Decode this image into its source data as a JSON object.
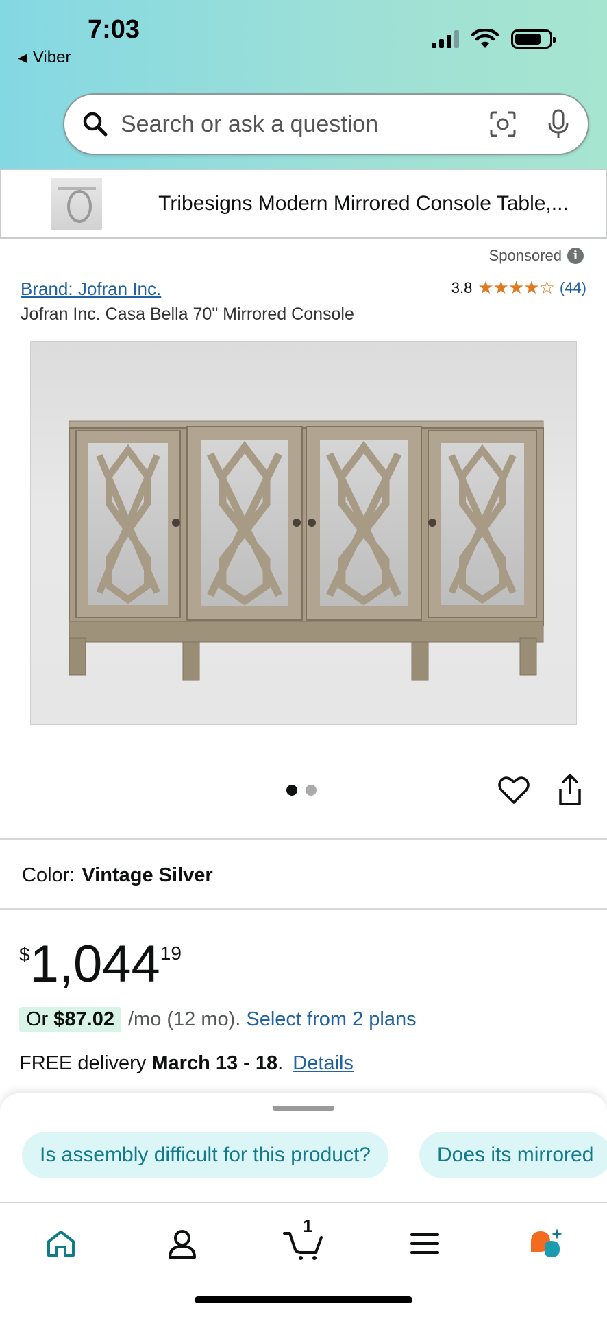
{
  "status_bar": {
    "time": "7:03",
    "back_app": "Viber"
  },
  "search": {
    "placeholder": "Search or ask a question",
    "left_icon": "search-icon",
    "camera_icon": "camera-scan-icon",
    "mic_icon": "microphone-icon"
  },
  "sponsored_product": {
    "title": "Tribesigns Modern Mirrored Console Table,..."
  },
  "ad": {
    "sponsored_label": "Sponsored",
    "info_icon": "i",
    "brand": "Brand: Jofran Inc.",
    "rating_value": "3.8",
    "rating_stars": "★★★★☆",
    "rating_count": "(44)",
    "title": "Jofran Inc. Casa Bella 70\" Mirrored Console"
  },
  "carousel": {
    "total": 2,
    "active_index": 0
  },
  "color": {
    "label": "Color:",
    "value": "Vintage Silver"
  },
  "price": {
    "currency": "$",
    "whole": "1,044",
    "fraction": "19"
  },
  "monthly": {
    "prefix": "Or ",
    "amount": "$87.02",
    "rest": "/mo (12 mo).",
    "plans_link": "Select from 2 plans"
  },
  "delivery": {
    "prefix": "FREE delivery ",
    "dates": "March 13 - 18",
    "suffix": ".",
    "details_link": "Details"
  },
  "rufus": {
    "chips": [
      "Is assembly difficult for this product?",
      "Does its mirrored"
    ]
  },
  "bottom_nav": {
    "cart_count": "1",
    "items": [
      "home-icon",
      "account-icon",
      "cart-icon",
      "menu-icon",
      "rufus-icon"
    ]
  },
  "colors": {
    "header_gradient_start": "#84d8e3",
    "header_gradient_end": "#a6e5cf",
    "link": "#2162a1",
    "star": "#de7921",
    "chip_bg": "#dcf5f7",
    "chip_text": "#117a8b",
    "price_pill": "#d8f4e6",
    "nav_home_active": "#117a8b",
    "rufus_orange": "#f26b21"
  }
}
